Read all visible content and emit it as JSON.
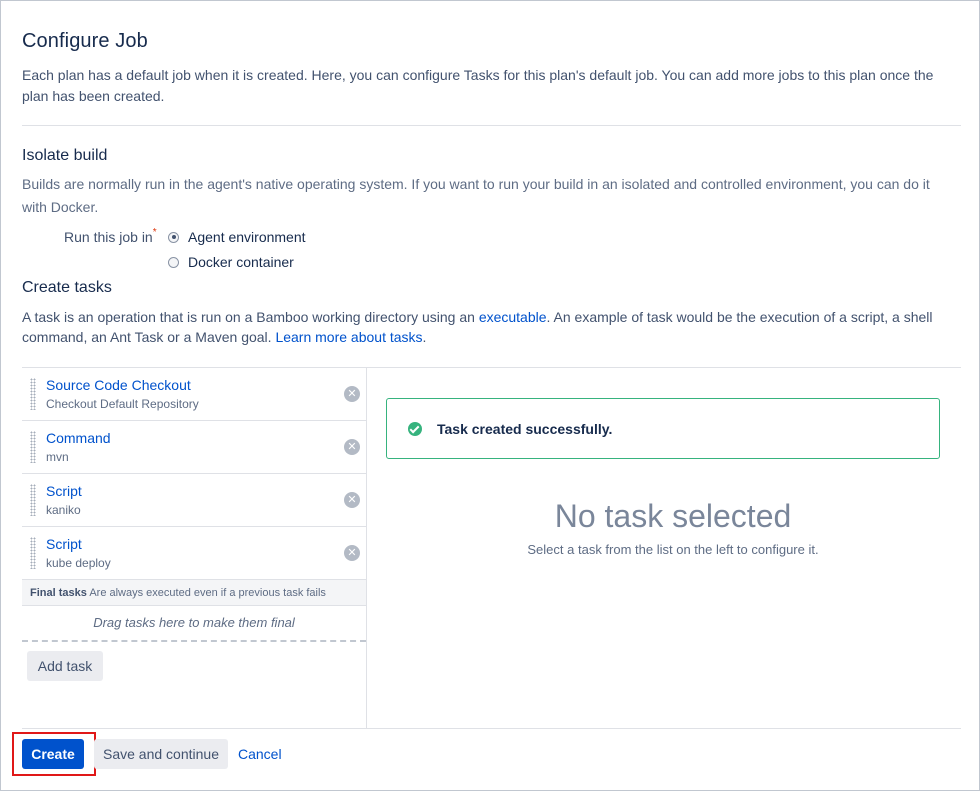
{
  "page": {
    "title": "Configure Job",
    "intro": "Each plan has a default job when it is created. Here, you can configure Tasks for this plan's default job. You can add more jobs to this plan once the plan has been created."
  },
  "isolate": {
    "title": "Isolate build",
    "description": "Builds are normally run in the agent's native operating system. If you want to run your build in an isolated and controlled environment, you can do it with Docker.",
    "run_label": "Run this job in",
    "required_mark": "*",
    "options": [
      {
        "label": "Agent environment",
        "selected": true
      },
      {
        "label": "Docker container",
        "selected": false
      }
    ]
  },
  "tasks_section": {
    "title": "Create tasks",
    "desc_part1": "A task is an operation that is run on a Bamboo working directory using an ",
    "desc_link1": "executable",
    "desc_part2": ". An example of task would be the execution of a script, a shell command, an Ant Task or a Maven goal. ",
    "desc_link2": "Learn more about tasks",
    "desc_part3": "."
  },
  "tasks": [
    {
      "title": "Source Code Checkout",
      "subtitle": "Checkout Default Repository"
    },
    {
      "title": "Command",
      "subtitle": "mvn"
    },
    {
      "title": "Script",
      "subtitle": "kaniko"
    },
    {
      "title": "Script",
      "subtitle": "kube deploy"
    }
  ],
  "final_tasks": {
    "label": "Final tasks",
    "note": "Are always executed even if a previous task fails",
    "drop_hint": "Drag tasks here to make them final"
  },
  "add_task_label": "Add task",
  "message": {
    "text": "Task created successfully.",
    "color": "#36b37e"
  },
  "empty_state": {
    "title": "No task selected",
    "subtitle": "Select a task from the list on the left to configure it."
  },
  "footer": {
    "create_label": "Create",
    "save_label": "Save and continue",
    "cancel_label": "Cancel"
  },
  "colors": {
    "primary": "#0052cc",
    "success": "#36b37e",
    "highlight": "#e01818"
  },
  "icons": {
    "task_remove": "close-circle-icon",
    "message": "check-circle-icon",
    "drag": "drag-handle-icon"
  }
}
